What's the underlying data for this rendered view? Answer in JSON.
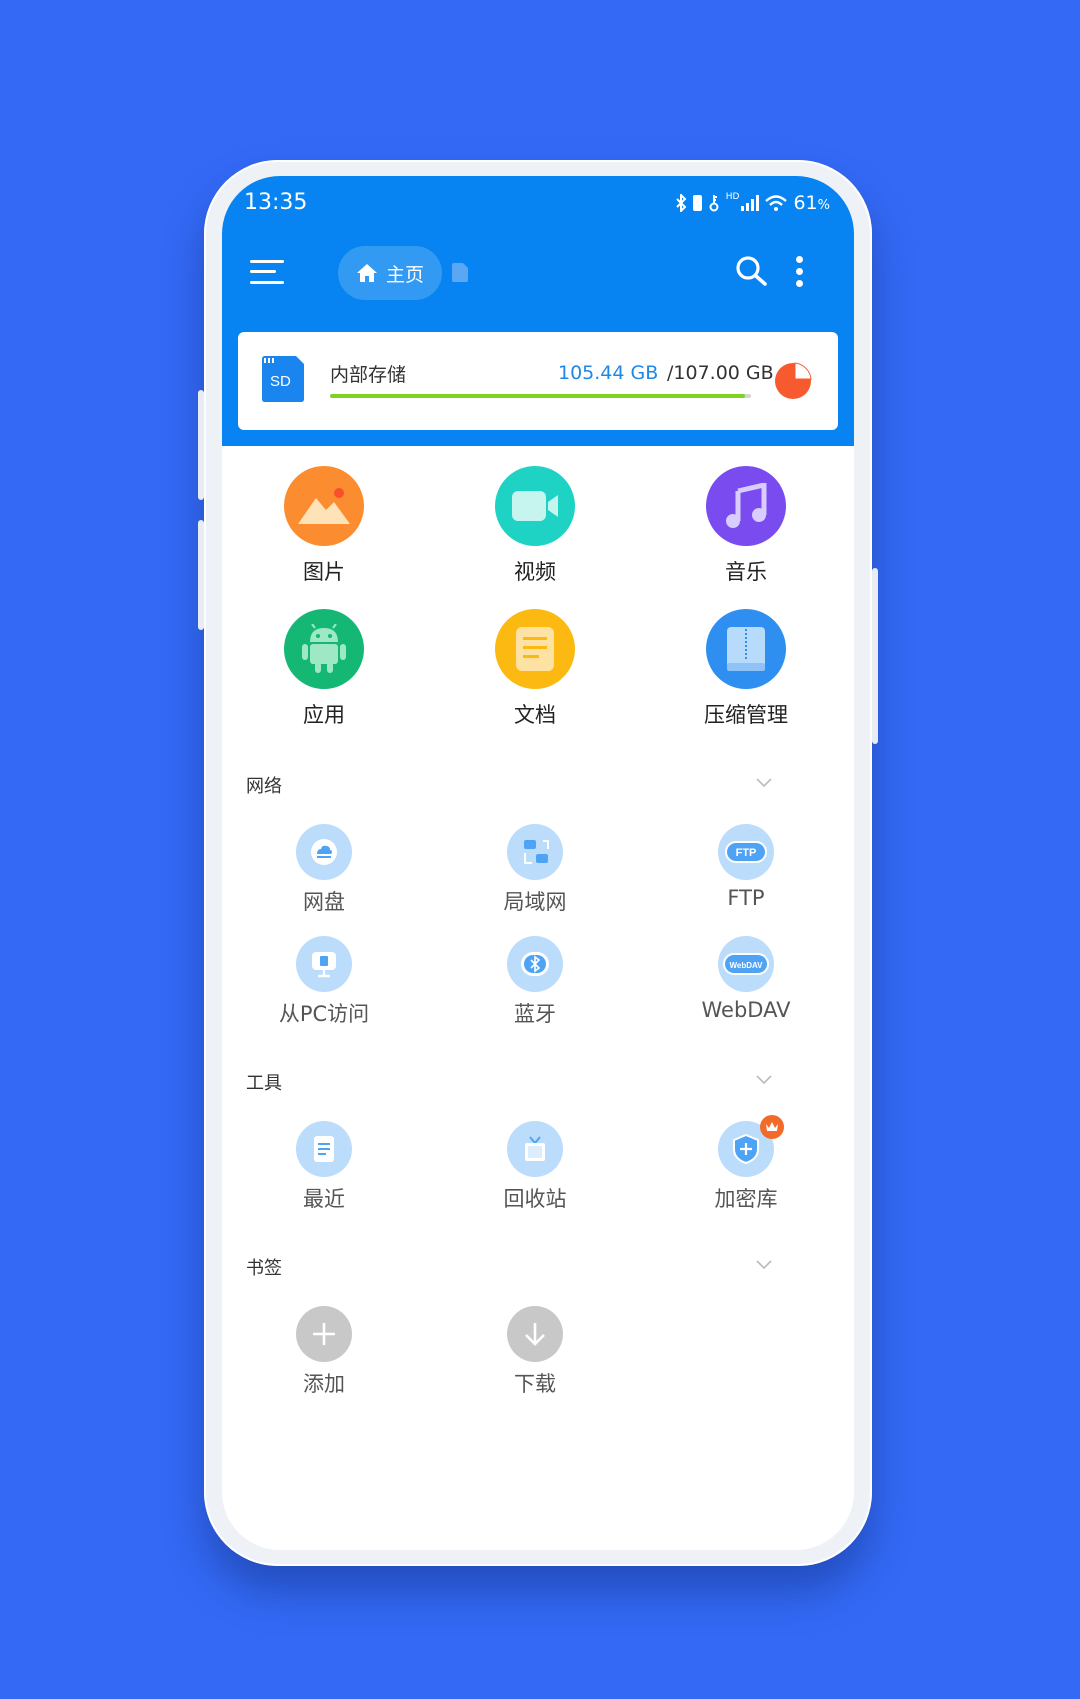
{
  "status_bar": {
    "time": "13:35",
    "battery_text": "61",
    "battery_unit": "%",
    "network_badge": "HD",
    "icons": [
      "bluetooth-icon",
      "battery-icon",
      "key-icon",
      "signal-icon",
      "wifi-icon"
    ]
  },
  "toolbar": {
    "home_label": "主页",
    "icons": [
      "menu-icon",
      "home-icon",
      "document-icon",
      "search-icon",
      "more-icon"
    ]
  },
  "storage": {
    "sd_text": "SD",
    "label": "内部存储",
    "used": "105.44 GB",
    "separator": "/",
    "total": "107.00 GB",
    "used_fraction": 0.985,
    "bar_color": "#7ed321",
    "pie_color": "#f75a2f"
  },
  "categories": [
    {
      "label": "图片",
      "icon": "image-icon",
      "color": "#fb8c2f"
    },
    {
      "label": "视频",
      "icon": "video-icon",
      "color": "#1ed3c4"
    },
    {
      "label": "音乐",
      "icon": "music-icon",
      "color": "#7a4cf0"
    },
    {
      "label": "应用",
      "icon": "android-icon",
      "color": "#14b874"
    },
    {
      "label": "文档",
      "icon": "document-icon",
      "color": "#fbb912"
    },
    {
      "label": "压缩管理",
      "icon": "archive-icon",
      "color": "#2e8ff0"
    }
  ],
  "sections": {
    "network": {
      "title": "网络",
      "items": [
        {
          "label": "网盘",
          "icon": "cloud-drive-icon"
        },
        {
          "label": "局域网",
          "icon": "lan-icon"
        },
        {
          "label": "FTP",
          "icon": "ftp-icon",
          "icon_text": "FTP"
        },
        {
          "label": "从PC访问",
          "icon": "pc-access-icon"
        },
        {
          "label": "蓝牙",
          "icon": "bluetooth-icon"
        },
        {
          "label": "WebDAV",
          "icon": "webdav-icon",
          "icon_text": "WebDAV"
        }
      ]
    },
    "tools": {
      "title": "工具",
      "items": [
        {
          "label": "最近",
          "icon": "recent-icon"
        },
        {
          "label": "回收站",
          "icon": "recycle-bin-icon"
        },
        {
          "label": "加密库",
          "icon": "vault-icon",
          "badge": "crown-icon"
        }
      ]
    },
    "bookmarks": {
      "title": "书签",
      "items": [
        {
          "label": "添加",
          "icon": "add-icon"
        },
        {
          "label": "下载",
          "icon": "download-icon"
        }
      ]
    }
  },
  "colors": {
    "background": "#3369f5",
    "header": "#0784f1",
    "tool_circle": "#bcdcfb",
    "tool_glyph": "#4fa3f5",
    "bookmark_circle": "#c8c8c8"
  }
}
